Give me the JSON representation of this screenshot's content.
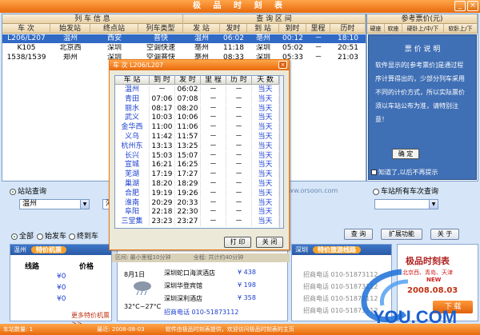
{
  "app": {
    "title": "极 品 时 刻 表",
    "minimize_label": "_",
    "close_label": "×"
  },
  "main_table": {
    "group_headers": [
      "列 车 信 息",
      "查 询 区 间",
      "参考票价(元)"
    ],
    "columns": [
      "车 次",
      "始发站",
      "终点站",
      "列车类型",
      "发 站",
      "发时",
      "到 站",
      "到时",
      "里程",
      "历时"
    ],
    "price_columns": [
      "硬座",
      "软座",
      "硬卧上/中/下",
      "软卧上/下"
    ],
    "rows": [
      [
        "L206/L207",
        "温州",
        "西安",
        "普快",
        "温州",
        "06:02",
        "亳州",
        "00:12",
        "－",
        "18:10"
      ],
      [
        "K105",
        "北京西",
        "深圳",
        "空调快速",
        "亳州",
        "11:18",
        "深圳",
        "05:02",
        "－",
        "20:51"
      ],
      [
        "1538/1539",
        "郑州",
        "深圳",
        "空调普快",
        "亳州",
        "08:33",
        "深圳",
        "05:33",
        "－",
        "21:03"
      ]
    ]
  },
  "notice": {
    "title": "票 价 说 明",
    "body": "软件显示的[参考票价]是通过程序计算得出的，少部分列车采用不同的计价方式，所以实际票价须以车站公布为准，请特别注意！",
    "ok_label": "确 定",
    "checkbox_label": "知道了,以后不再提示"
  },
  "dialog": {
    "title": "车 次 L206/L207",
    "close_label": "×",
    "columns": [
      "车 站",
      "到 时",
      "发 时",
      "里 程",
      "历 时",
      "天 数"
    ],
    "rows": [
      [
        "温州",
        "－",
        "06:02",
        "－",
        "－",
        "当天"
      ],
      [
        "青田",
        "07:06",
        "07:08",
        "－",
        "－",
        "当天"
      ],
      [
        "丽水",
        "08:17",
        "08:20",
        "－",
        "－",
        "当天"
      ],
      [
        "武义",
        "10:03",
        "10:06",
        "－",
        "－",
        "当天"
      ],
      [
        "金华西",
        "11:00",
        "11:06",
        "－",
        "－",
        "当天"
      ],
      [
        "义乌",
        "11:42",
        "11:57",
        "－",
        "－",
        "当天"
      ],
      [
        "杭州东",
        "13:13",
        "13:25",
        "－",
        "－",
        "当天"
      ],
      [
        "长兴",
        "15:03",
        "15:07",
        "－",
        "－",
        "当天"
      ],
      [
        "宣城",
        "16:21",
        "16:25",
        "－",
        "－",
        "当天"
      ],
      [
        "芜湖",
        "17:19",
        "17:27",
        "－",
        "－",
        "当天"
      ],
      [
        "巢湖",
        "18:20",
        "18:29",
        "－",
        "－",
        "当天"
      ],
      [
        "合肥",
        "19:19",
        "19:26",
        "－",
        "－",
        "当天"
      ],
      [
        "淮南",
        "20:29",
        "20:33",
        "－",
        "－",
        "当天"
      ],
      [
        "阜阳",
        "22:18",
        "22:30",
        "－",
        "－",
        "当天"
      ],
      [
        "三堂集",
        "23:23",
        "23:27",
        "－",
        "－",
        "当天"
      ]
    ],
    "print_label": "打 印",
    "close_button_label": "关 闭"
  },
  "query": {
    "station_query_label": "站站查询",
    "station_trains_label": "车站所有车次查询",
    "from_station": "温州",
    "to_station": "河",
    "watermark": "www.orsoon.com",
    "filter_options": [
      "全部",
      "始发车",
      "终到车"
    ],
    "query_button": "查 询",
    "extend_button": "扩展功能",
    "about_button": "关 于"
  },
  "bottom": {
    "ticket_panel_city": "温州",
    "ticket_panel_title": "特价机票",
    "ticket_route_header": "线路",
    "ticket_price_header": "价格",
    "price_symbol": "¥0",
    "more_tickets": "更多特价机票>>",
    "weather_date": "8月1日",
    "weather_temp": "32°C~27°C",
    "transit_text_1": "区间: 最小里程10分钟",
    "transit_text_2": "全程: 共计约40分钟",
    "hotels": [
      {
        "name": "深圳蛇口海滨酒店",
        "price": "¥ 438"
      },
      {
        "name": "深圳华登宾馆",
        "price": "¥ 198"
      },
      {
        "name": "深圳深利酒店",
        "price": "¥ 358"
      }
    ],
    "hotel_phone": "招商电话 010-51873112",
    "tour_city": "深圳",
    "tour_title": "特价旅游线路",
    "tour_items": [
      "招商电话 010-51873112",
      "招商电话 010-51873112",
      "招商电话 010-51873112",
      "招商电话 010-51873112"
    ],
    "brand_title": "极品时刻表",
    "brand_cities": "北京西、青岛、天津",
    "brand_new": "NEW",
    "brand_date": "2008.08.03",
    "download_label": "下 载",
    "logo_text": "YOU.COM"
  },
  "status": {
    "left": "车站数量: 1",
    "date": "最近: 2008-08-03",
    "message": "软件由极品时刻表提供，欢迎访问极品时刻表的主页"
  },
  "colors": {
    "accent": "#e86a0c",
    "selection": "#316ac5",
    "notice_bg": "#3f6fb5"
  }
}
